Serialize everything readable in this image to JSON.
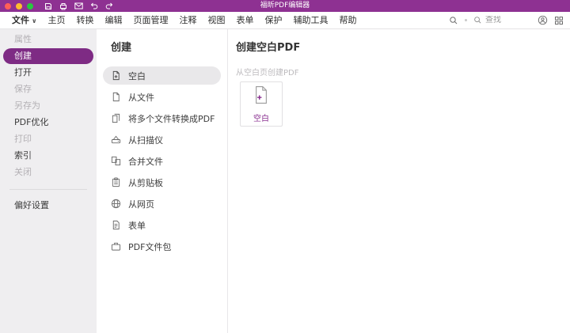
{
  "titlebar": {
    "title": "福昕PDF编辑器"
  },
  "menubar": {
    "items": [
      {
        "label": "文件"
      },
      {
        "label": "主页"
      },
      {
        "label": "转换"
      },
      {
        "label": "编辑"
      },
      {
        "label": "页面管理"
      },
      {
        "label": "注释"
      },
      {
        "label": "视图"
      },
      {
        "label": "表单"
      },
      {
        "label": "保护"
      },
      {
        "label": "辅助工具"
      },
      {
        "label": "帮助"
      }
    ],
    "search": {
      "placeholder": "查找"
    }
  },
  "sidebar": {
    "items": [
      {
        "label": "属性",
        "state": "disabled"
      },
      {
        "label": "创建",
        "state": "active"
      },
      {
        "label": "打开",
        "state": "normal"
      },
      {
        "label": "保存",
        "state": "disabled"
      },
      {
        "label": "另存为",
        "state": "disabled"
      },
      {
        "label": "PDF优化",
        "state": "normal"
      },
      {
        "label": "打印",
        "state": "disabled"
      },
      {
        "label": "索引",
        "state": "normal"
      },
      {
        "label": "关闭",
        "state": "disabled"
      }
    ],
    "footer": {
      "label": "偏好设置"
    }
  },
  "create_panel": {
    "title": "创建",
    "items": [
      {
        "label": "空白",
        "selected": true
      },
      {
        "label": "从文件"
      },
      {
        "label": "将多个文件转换成PDF"
      },
      {
        "label": "从扫描仪"
      },
      {
        "label": "合并文件"
      },
      {
        "label": "从剪贴板"
      },
      {
        "label": "从网页"
      },
      {
        "label": "表单"
      },
      {
        "label": "PDF文件包"
      }
    ]
  },
  "detail_panel": {
    "title": "创建空白PDF",
    "subtitle": "从空白页创建PDF",
    "card_label": "空白"
  },
  "colors": {
    "titlebar": "#8e3192",
    "accent": "#7e2b84",
    "sidebar_bg": "#efeef0",
    "selected_row_bg": "#e9e8ea",
    "disabled_text": "#b3b0b4",
    "card_label": "#8a2f90",
    "traffic_red": "#ff5f57",
    "traffic_yellow": "#febc2e",
    "traffic_green": "#28c840"
  }
}
